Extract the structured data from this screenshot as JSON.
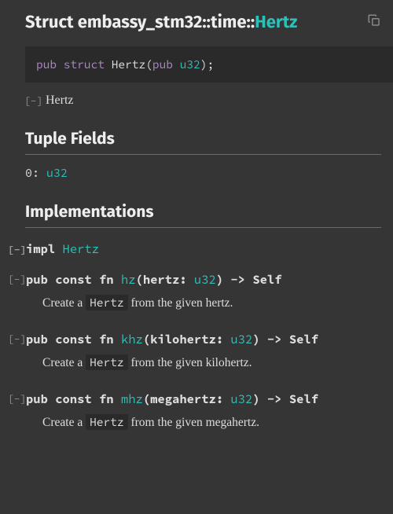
{
  "title": {
    "prefix": "Struct ",
    "path": "embassy_stm32::time::",
    "name": "Hertz"
  },
  "declaration": {
    "kw1": "pub struct",
    "name": "Hertz",
    "paren_open": "(",
    "vis": "pub",
    "type": "u32",
    "paren_close": ");"
  },
  "toggle": "[−]",
  "summary": "Hertz",
  "sections": {
    "tuple_fields": "Tuple Fields",
    "implementations": "Implementations"
  },
  "tuple_field": {
    "index": "0: ",
    "type": "u32"
  },
  "impl": {
    "kw": "impl ",
    "type": "Hertz"
  },
  "methods": [
    {
      "prefix": "pub const fn ",
      "name": "hz",
      "params_open": "(hertz: ",
      "ptype": "u32",
      "params_close": ") -> Self",
      "desc_pre": "Create a ",
      "desc_code": "Hertz",
      "desc_post": " from the given hertz."
    },
    {
      "prefix": "pub const fn ",
      "name": "khz",
      "params_open": "(kilohertz: ",
      "ptype": "u32",
      "params_close": ") -> Self",
      "desc_pre": "Create a ",
      "desc_code": "Hertz",
      "desc_post": " from the given kilohertz."
    },
    {
      "prefix": "pub const fn ",
      "name": "mhz",
      "params_open": "(megahertz: ",
      "ptype": "u32",
      "params_close": ") -> Self",
      "desc_pre": "Create a ",
      "desc_code": "Hertz",
      "desc_post": " from the given megahertz."
    }
  ]
}
